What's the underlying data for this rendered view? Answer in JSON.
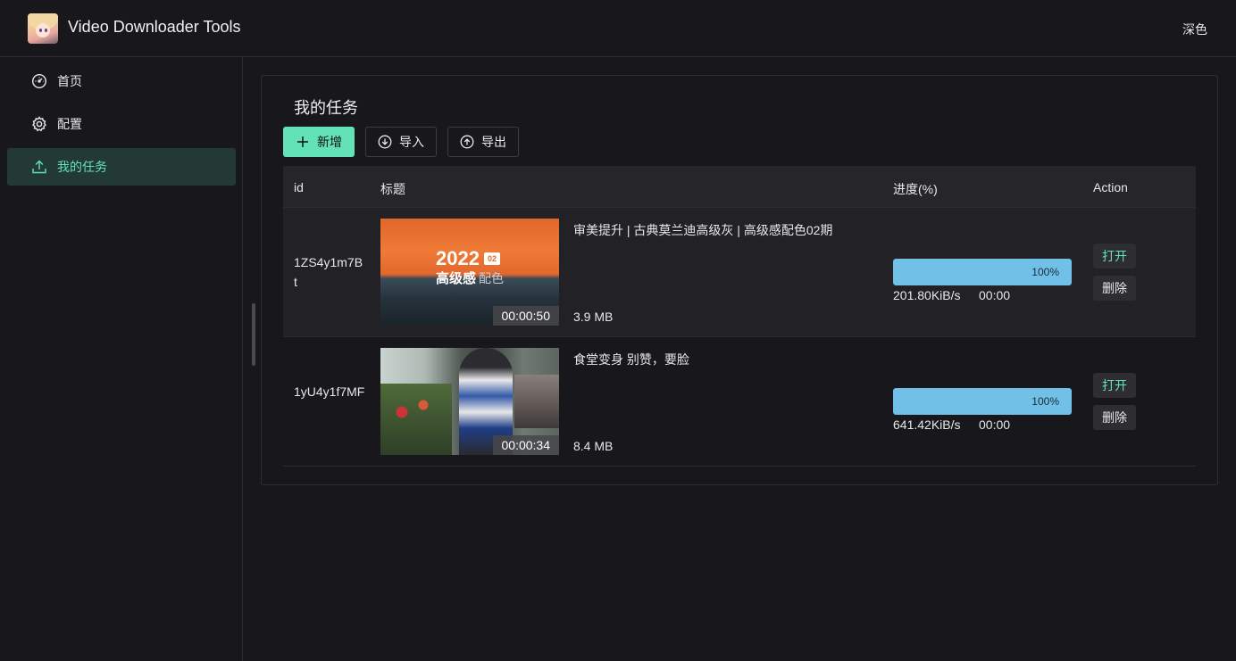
{
  "header": {
    "title": "Video Downloader Tools",
    "theme_label": "深色"
  },
  "sidebar": {
    "items": [
      {
        "label": "首页",
        "icon": "dashboard-icon"
      },
      {
        "label": "配置",
        "icon": "gear-icon"
      },
      {
        "label": "我的任务",
        "icon": "upload-icon",
        "active": true
      }
    ]
  },
  "page": {
    "title": "我的任务",
    "buttons": {
      "add": "新增",
      "import": "导入",
      "export": "导出"
    }
  },
  "table": {
    "columns": {
      "id": "id",
      "title": "标题",
      "progress": "进度(%)",
      "action": "Action"
    },
    "rows": [
      {
        "id": "1ZS4y1m7Bt",
        "title": "审美提升 | 古典莫兰迪高级灰 | 高级感配色02期",
        "duration": "00:00:50",
        "size": "3.9 MB",
        "progress": 100,
        "progress_label": "100%",
        "speed": "201.80KiB/s",
        "eta": "00:00",
        "open_label": "打开",
        "delete_label": "删除"
      },
      {
        "id": "1yU4y1f7MF",
        "title": "食堂变身 别赞，要脸",
        "duration": "00:00:34",
        "size": "8.4 MB",
        "progress": 100,
        "progress_label": "100%",
        "speed": "641.42KiB/s",
        "eta": "00:00",
        "open_label": "打开",
        "delete_label": "删除"
      }
    ]
  },
  "thumb1": {
    "big": "2022",
    "sub": "高级感",
    "sub2": "配色",
    "tag": "02"
  },
  "colors": {
    "accent": "#63e2b7",
    "progress": "#70c0e8",
    "bg": "#18181c"
  }
}
